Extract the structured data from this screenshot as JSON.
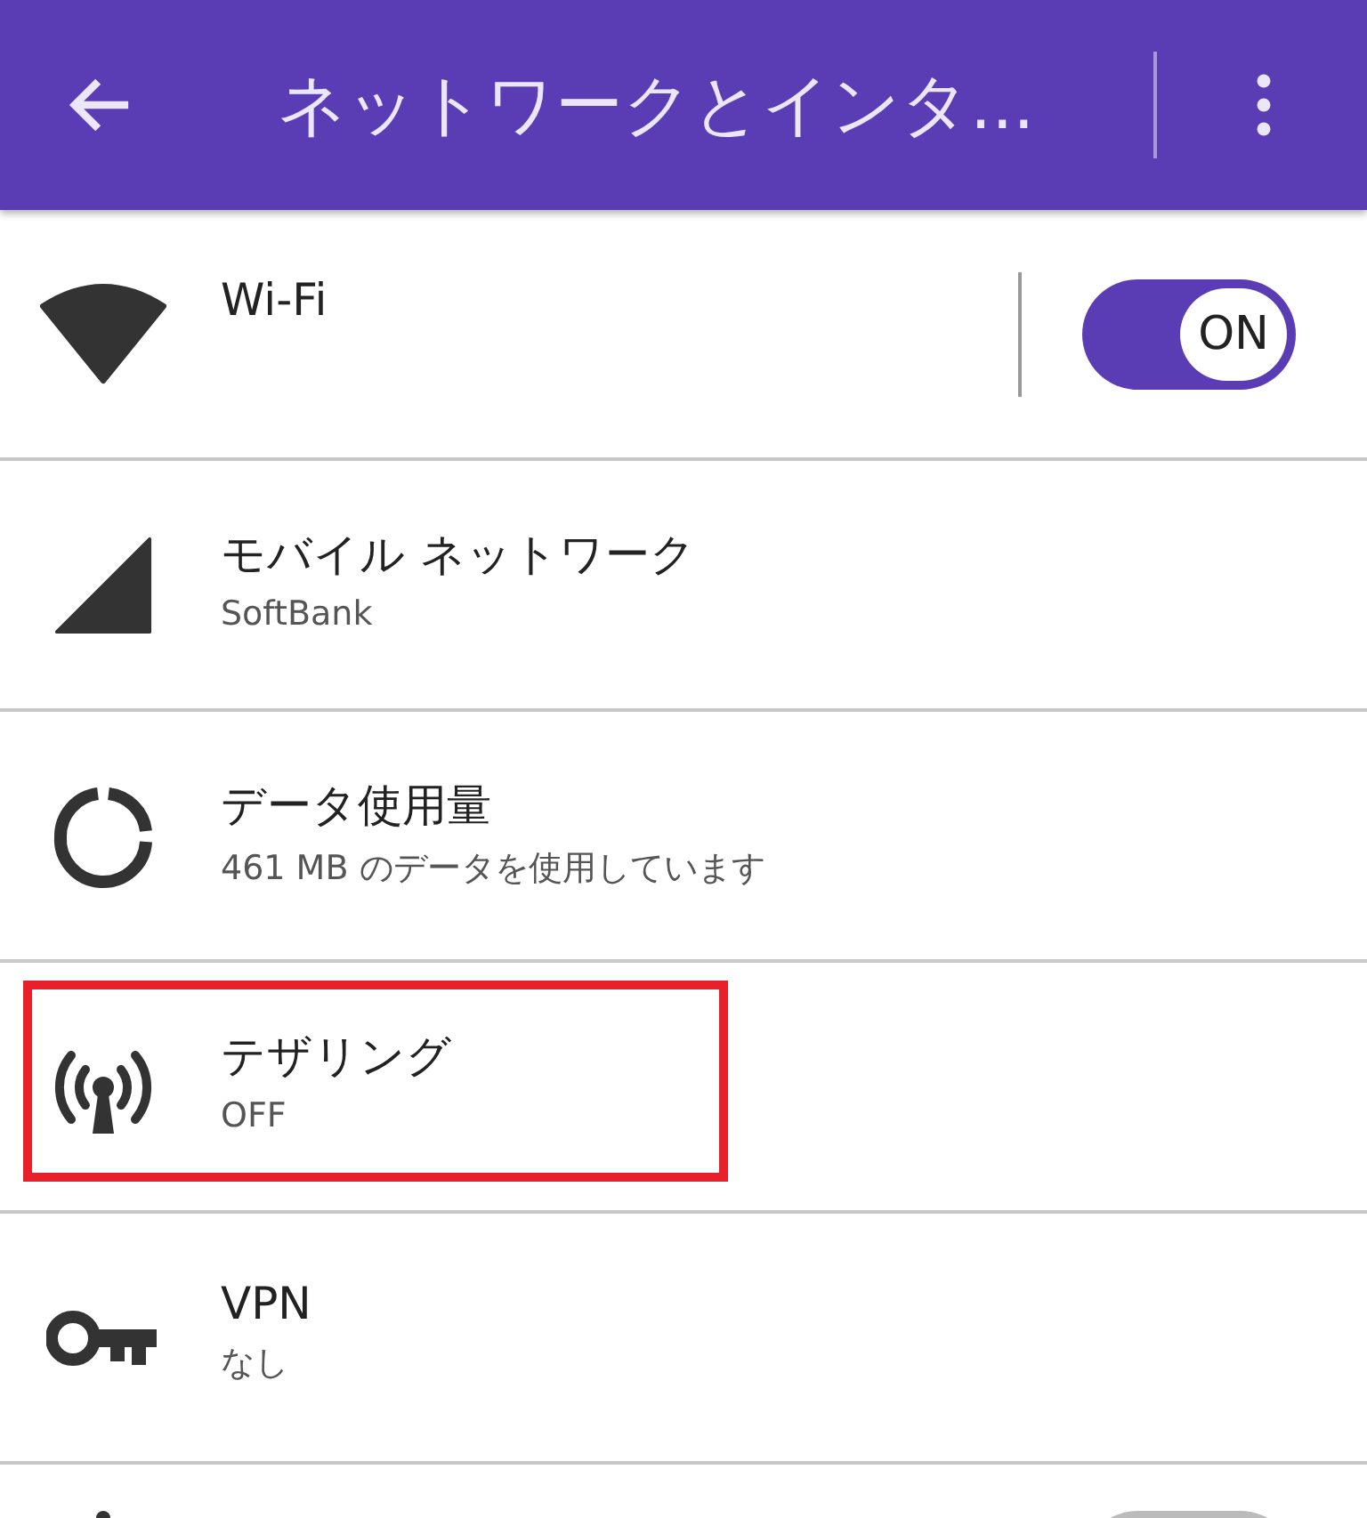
{
  "app_bar": {
    "title": "ネットワークとインタ..."
  },
  "items": [
    {
      "title": "Wi-Fi",
      "toggle": {
        "on": true,
        "label": "ON"
      },
      "highlighted": false
    },
    {
      "title": "モバイル ネットワーク",
      "subtitle": "SoftBank",
      "highlighted": false
    },
    {
      "title": "データ使用量",
      "subtitle": "461 MB のデータを使用しています",
      "highlighted": false
    },
    {
      "title": "テザリング",
      "subtitle": "OFF",
      "highlighted": true
    },
    {
      "title": "VPN",
      "subtitle": "なし",
      "highlighted": false
    },
    {
      "toggle": {
        "on": false
      },
      "highlighted": false
    }
  ]
}
